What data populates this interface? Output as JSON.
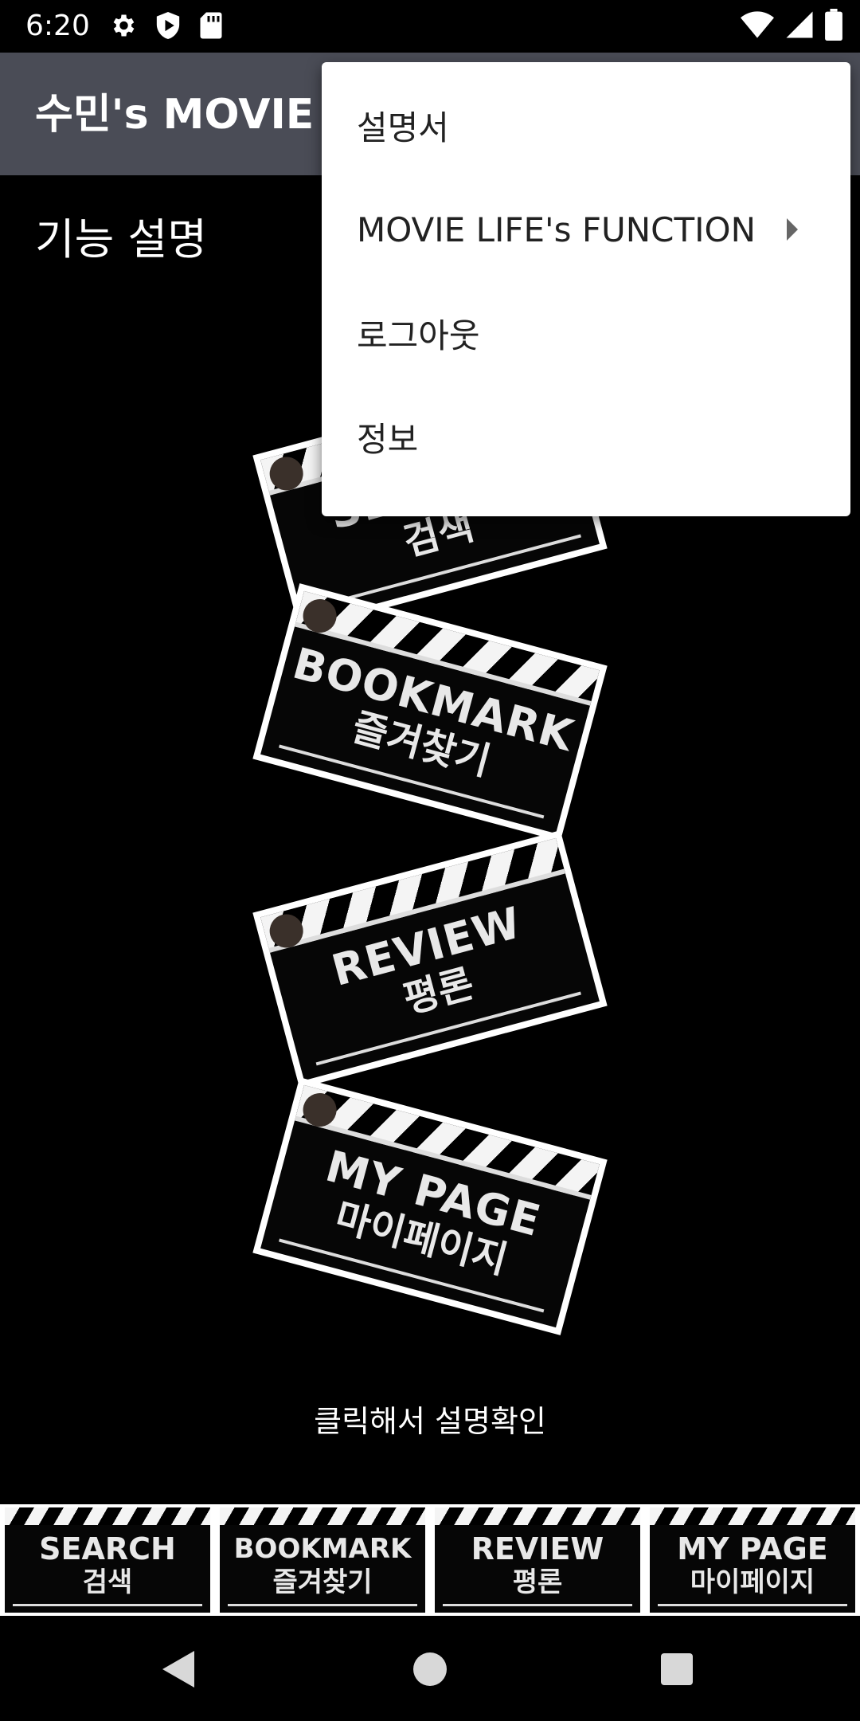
{
  "status_bar": {
    "time": "6:20",
    "left_icons": [
      "gear-icon",
      "shield-play-icon",
      "sd-card-icon"
    ],
    "right_icons": [
      "wifi-icon",
      "cellular-signal-icon",
      "battery-icon"
    ]
  },
  "app_bar": {
    "title": "수민's MOVIE LIFE"
  },
  "section_title": "기능 설명",
  "cards": [
    {
      "en": "SEARCH",
      "ko": "검색"
    },
    {
      "en": "BOOKMARK",
      "ko": "즐겨찾기"
    },
    {
      "en": "REVIEW",
      "ko": "평론"
    },
    {
      "en": "MY PAGE",
      "ko": "마이페이지"
    }
  ],
  "caption": "클릭해서 설명확인",
  "tabs": [
    {
      "en": "SEARCH",
      "ko": "검색"
    },
    {
      "en": "BOOKMARK",
      "ko": "즐겨찾기"
    },
    {
      "en": "REVIEW",
      "ko": "평론"
    },
    {
      "en": "MY PAGE",
      "ko": "마이페이지"
    }
  ],
  "menu": {
    "items": [
      {
        "label": "설명서"
      },
      {
        "label": "MOVIE LIFE's FUNCTION",
        "has_submenu": true
      },
      {
        "label": "로그아웃"
      },
      {
        "label": "정보"
      }
    ]
  },
  "nav_bar": {
    "icons": [
      "back-icon",
      "home-icon",
      "recents-icon"
    ]
  },
  "colors": {
    "app_bar": "#4a4c56",
    "background": "#000000",
    "menu_background": "#ffffff",
    "menu_text": "#222222"
  }
}
